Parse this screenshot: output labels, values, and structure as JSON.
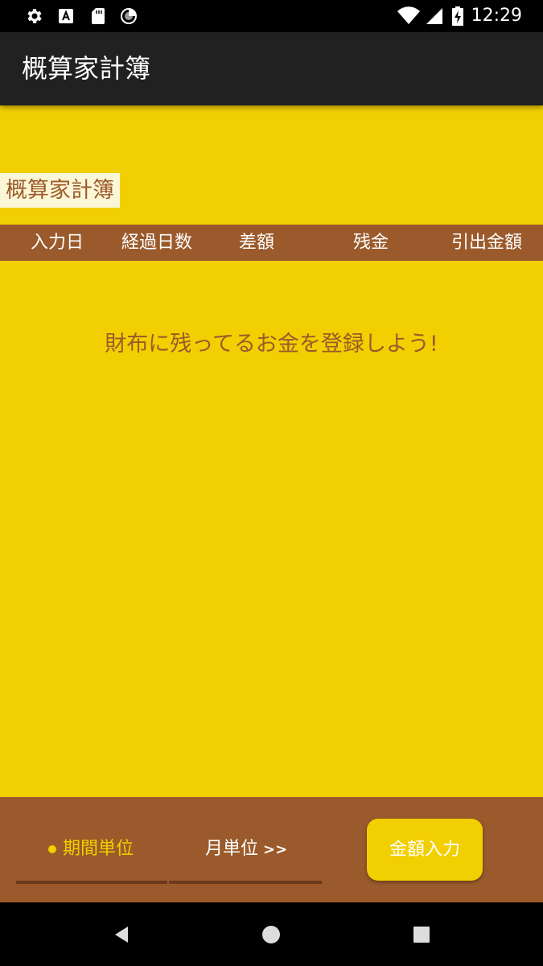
{
  "status_bar": {
    "time": "12:29",
    "icons": [
      "gear-icon",
      "keyboard-a-icon",
      "sd-card-icon",
      "sync-icon",
      "wifi-icon",
      "signal-icon",
      "battery-charging-icon"
    ]
  },
  "app_bar": {
    "title": "概算家計簿"
  },
  "section": {
    "label": "概算家計簿"
  },
  "table": {
    "columns": [
      "入力日",
      "経過日数",
      "差額",
      "残金",
      "引出金額"
    ]
  },
  "empty_message": "財布に残ってるお金を登録しよう!",
  "bottom": {
    "tab_period": "期間単位",
    "tab_month": "月単位",
    "tab_month_arrow": ">>",
    "input_button": "金額入力"
  },
  "nav_bar": {
    "icons": [
      "back-icon",
      "home-icon",
      "recents-icon"
    ]
  },
  "colors": {
    "background": "#f2cf00",
    "brown": "#9b5a2b",
    "app_bar": "#212121"
  }
}
